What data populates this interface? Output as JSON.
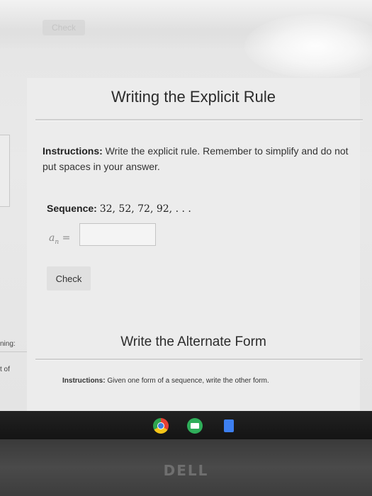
{
  "top_faint_button": "Check",
  "left_panel": {
    "text_1": "ning:",
    "text_2": "t of"
  },
  "section_1": {
    "title": "Writing the Explicit Rule",
    "instructions_label": "Instructions:",
    "instructions_text": "Write the explicit rule. Remember to simplify and do not put spaces in your answer.",
    "sequence_label": "Sequence:",
    "sequence_values": "32, 52, 72, 92, . . .",
    "answer_label_var": "a",
    "answer_label_sub": "n",
    "answer_label_eq": " =",
    "answer_value": "",
    "check_button": "Check"
  },
  "section_2": {
    "title": "Write the Alternate Form",
    "instructions_label": "Instructions:",
    "instructions_text": "Given one form of a sequence, write the other form."
  },
  "taskbar": {
    "icons": [
      "chrome-icon",
      "files-icon",
      "docs-icon"
    ]
  },
  "bezel": {
    "logo": "DELL"
  }
}
